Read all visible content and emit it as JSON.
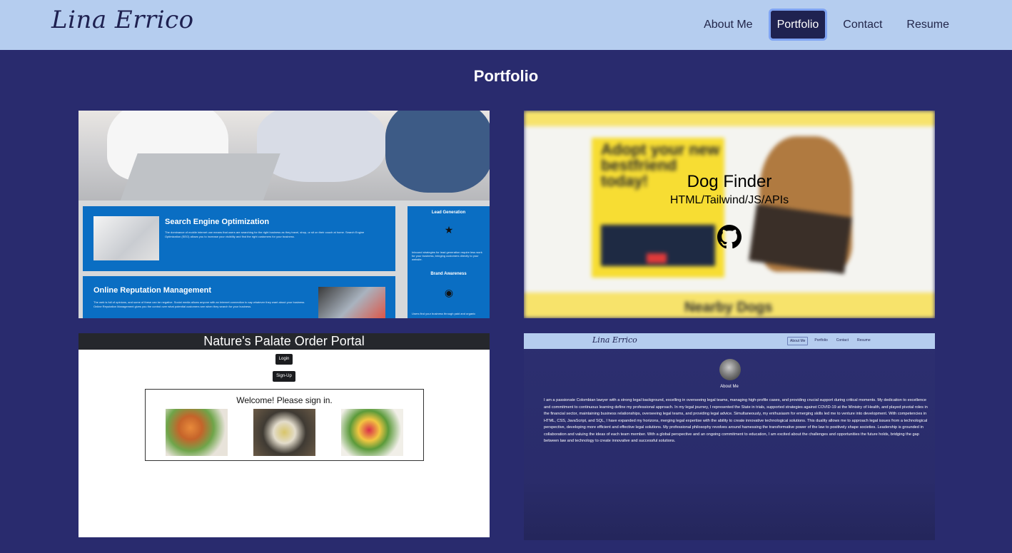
{
  "header": {
    "brand": "Lina Errico",
    "nav": [
      {
        "label": "About Me"
      },
      {
        "label": "Portfolio",
        "active": true
      },
      {
        "label": "Contact"
      },
      {
        "label": "Resume"
      }
    ]
  },
  "page": {
    "title": "Portfolio"
  },
  "projects": [
    {
      "id": "marketing",
      "screenshot": {
        "heading_1": "Search Engine Optimization",
        "body_1": "The dominance of mobile internet use means that users are searching for the right business as they travel, shop, or sit on their couch at home. Search Engine Optimization (SEO) allows you to increase your visibility and find the right customers for your business.",
        "heading_2": "Online Reputation Management",
        "body_2": "The web is full of opinions, and some of these can be negative. Social media allows anyone with an Internet connection to say whatever they want about your business. Online Reputation Management gives you the control over what potential customers see when they search for your business.",
        "side_1_title": "Lead Generation",
        "side_1_text": "Inbound strategies for lead generation require less work for your business, bringing customers directly to your website.",
        "side_2_title": "Brand Awareness",
        "side_2_text": "Users find your business through paid and organic"
      }
    },
    {
      "id": "dog-finder",
      "title": "Dog Finder",
      "tech": "HTML/Tailwind/JS/APIs",
      "icon": "github-icon",
      "screenshot": {
        "hero": "Adopt your new bestfriend today!",
        "footer": "Nearby Dogs"
      }
    },
    {
      "id": "natures-palate",
      "screenshot": {
        "title": "Nature's Palate Order Portal",
        "login": "Login",
        "signup": "Sign-Up",
        "welcome": "Welcome! Please sign in."
      }
    },
    {
      "id": "about-me",
      "screenshot": {
        "brand": "Lina Errico",
        "nav": [
          "About Me",
          "Portfolio",
          "Contact",
          "Resume"
        ],
        "heading": "About Me",
        "bio": "I am a passionate Colombian lawyer with a strong legal background, excelling in overseeing legal teams, managing high-profile cases, and providing crucial support during critical moments. My dedication to excellence and commitment to continuous learning define my professional approach. In my legal journey, I represented the State in trials, supported strategies against COVID-19 at the Ministry of Health, and played pivotal roles in the financial sector, maintaining business relationships, overseeing legal teams, and providing legal advice. Simultaneously, my enthusiasm for emerging skills led me to venture into development. With competencies in HTML, CSS, JavaScript, and SQL, I have expanded my horizons, merging legal expertise with the ability to create innovative technological solutions. This duality allows me to approach legal issues from a technological perspective, developing more efficient and effective legal solutions. My professional philosophy revolves around harnessing the transformative power of the law to positively shape societies. Leadership is grounded in collaboration and valuing the ideas of each team member. With a global perspective and an ongoing commitment to education, I am excited about the challenges and opportunities the future holds, bridging the gap between law and technology to create innovative and successful solutions."
      }
    }
  ],
  "colors": {
    "nav_bg": "#b5cdef",
    "page_bg": "#292b6e",
    "active_nav": "#1f2250",
    "seo_blue": "#0a6ec3",
    "dog_yellow": "#f7dd33"
  }
}
